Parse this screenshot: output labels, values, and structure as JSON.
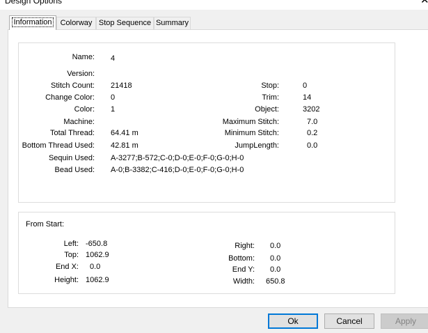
{
  "window": {
    "title": "Design Options"
  },
  "tabs": [
    {
      "label": "Information"
    },
    {
      "label": "Colorway"
    },
    {
      "label": "Stop Sequence"
    },
    {
      "label": "Summary"
    }
  ],
  "info": {
    "name_label": "Name:",
    "name_value": "4",
    "version_label": "Version:",
    "version_value": "",
    "stitch_count_label": "Stitch Count:",
    "stitch_count_value": "21418",
    "change_color_label": "Change Color:",
    "change_color_value": "0",
    "color_label": "Color:",
    "color_value": "1",
    "machine_label": "Machine:",
    "machine_value": "",
    "total_thread_label": "Total Thread:",
    "total_thread_value": "64.41 m",
    "bottom_thread_label": "Bottom Thread Used:",
    "bottom_thread_value": "42.81 m",
    "sequin_label": "Sequin Used:",
    "sequin_value": "A-3277;B-572;C-0;D-0;E-0;F-0;G-0;H-0",
    "bead_label": "Bead Used:",
    "bead_value": "A-0;B-3382;C-416;D-0;E-0;F-0;G-0;H-0",
    "stop_label": "Stop:",
    "stop_value": "0",
    "trim_label": "Trim:",
    "trim_value": "14",
    "object_label": "Object:",
    "object_value": "3202",
    "max_stitch_label": "Maximum Stitch:",
    "max_stitch_value": "7.0",
    "min_stitch_label": "Minimum Stitch:",
    "min_stitch_value": "0.2",
    "jump_length_label": "JumpLength:",
    "jump_length_value": "0.0"
  },
  "from_start": {
    "heading": "From Start:",
    "left_label": "Left:",
    "left_value": "-650.8",
    "top_label": "Top:",
    "top_value": "1062.9",
    "endx_label": "End X:",
    "endx_value": "0.0",
    "height_label": "Height:",
    "height_value": "1062.9",
    "right_label": "Right:",
    "right_value": "0.0",
    "bottom_label": "Bottom:",
    "bottom_value": "0.0",
    "endy_label": "End Y:",
    "endy_value": "0.0",
    "width_label": "Width:",
    "width_value": "650.8"
  },
  "buttons": {
    "ok": "Ok",
    "cancel": "Cancel",
    "apply": "Apply"
  },
  "colors": {
    "default_button_border": "#0078d7"
  },
  "icons": {
    "close": "close-icon"
  }
}
